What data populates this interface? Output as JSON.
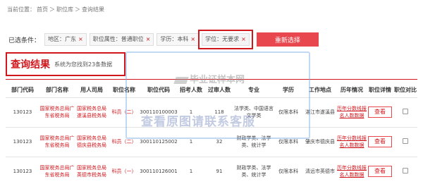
{
  "breadcrumb": [
    "当前位置：",
    "首页",
    "＞",
    "职位库",
    "＞",
    "查询结果"
  ],
  "filters": {
    "label": "已选条件：",
    "chips": [
      {
        "text": "地区：广东"
      },
      {
        "text": "职位属性：普通职位"
      },
      {
        "text": "学历：本科"
      },
      {
        "text": "学位：无要求"
      }
    ],
    "close_glyph": "×",
    "reset_label": "重新选择"
  },
  "result": {
    "title": "查询结果",
    "count_text": "系统为您找到23条数据"
  },
  "table": {
    "headers": [
      "部门代码",
      "部门名称",
      "用人司局",
      "职位名称",
      "职位代码",
      "招考人数",
      "过审人数",
      "专业",
      "学历",
      "工作地点",
      "历年情况",
      "职位详情",
      "职位对比"
    ],
    "rows": [
      {
        "dept_code": "130123",
        "dept_name": "国家税务总局广东省税务局",
        "bureau": "国家税务总局遂溪县税务局",
        "position": "科员（二）",
        "position_code": "300110100003",
        "recruit": "1",
        "approved": "118",
        "major": "法学类、中国语言文学类",
        "education": "仅限本科",
        "location": "湛江市遂溪县",
        "history": "历年分数线报名人数数据",
        "detail": "查看"
      },
      {
        "dept_code": "130123",
        "dept_name": "国家税务总局广东省税务局",
        "bureau": "国家税务总局德庆县税务局",
        "position": "科员（二）",
        "position_code": "300110125002",
        "recruit": "1",
        "approved": "32",
        "major": "财政学类、法学类、统计学",
        "education": "仅限本科",
        "location": "肇庆市德庆县",
        "history": "历年分数线报名人数数据",
        "detail": "查看"
      },
      {
        "dept_code": "130123",
        "dept_name": "国家税务总局广东省税务局",
        "bureau": "国家税务总局英德市税务局",
        "position": "科员（一）",
        "position_code": "300110126001",
        "recruit": "1",
        "approved": "91",
        "major": "财政学类、法学类、统计学",
        "education": "仅限本科",
        "location": "清远市英德市",
        "history": "历年分数线报名人数数据",
        "detail": "查看"
      }
    ]
  },
  "watermark": {
    "line1": "毕业证样本网",
    "line2": "查看原图请联系客服"
  },
  "colors": {
    "accent": "#d0171d",
    "button": "#e8474d"
  }
}
